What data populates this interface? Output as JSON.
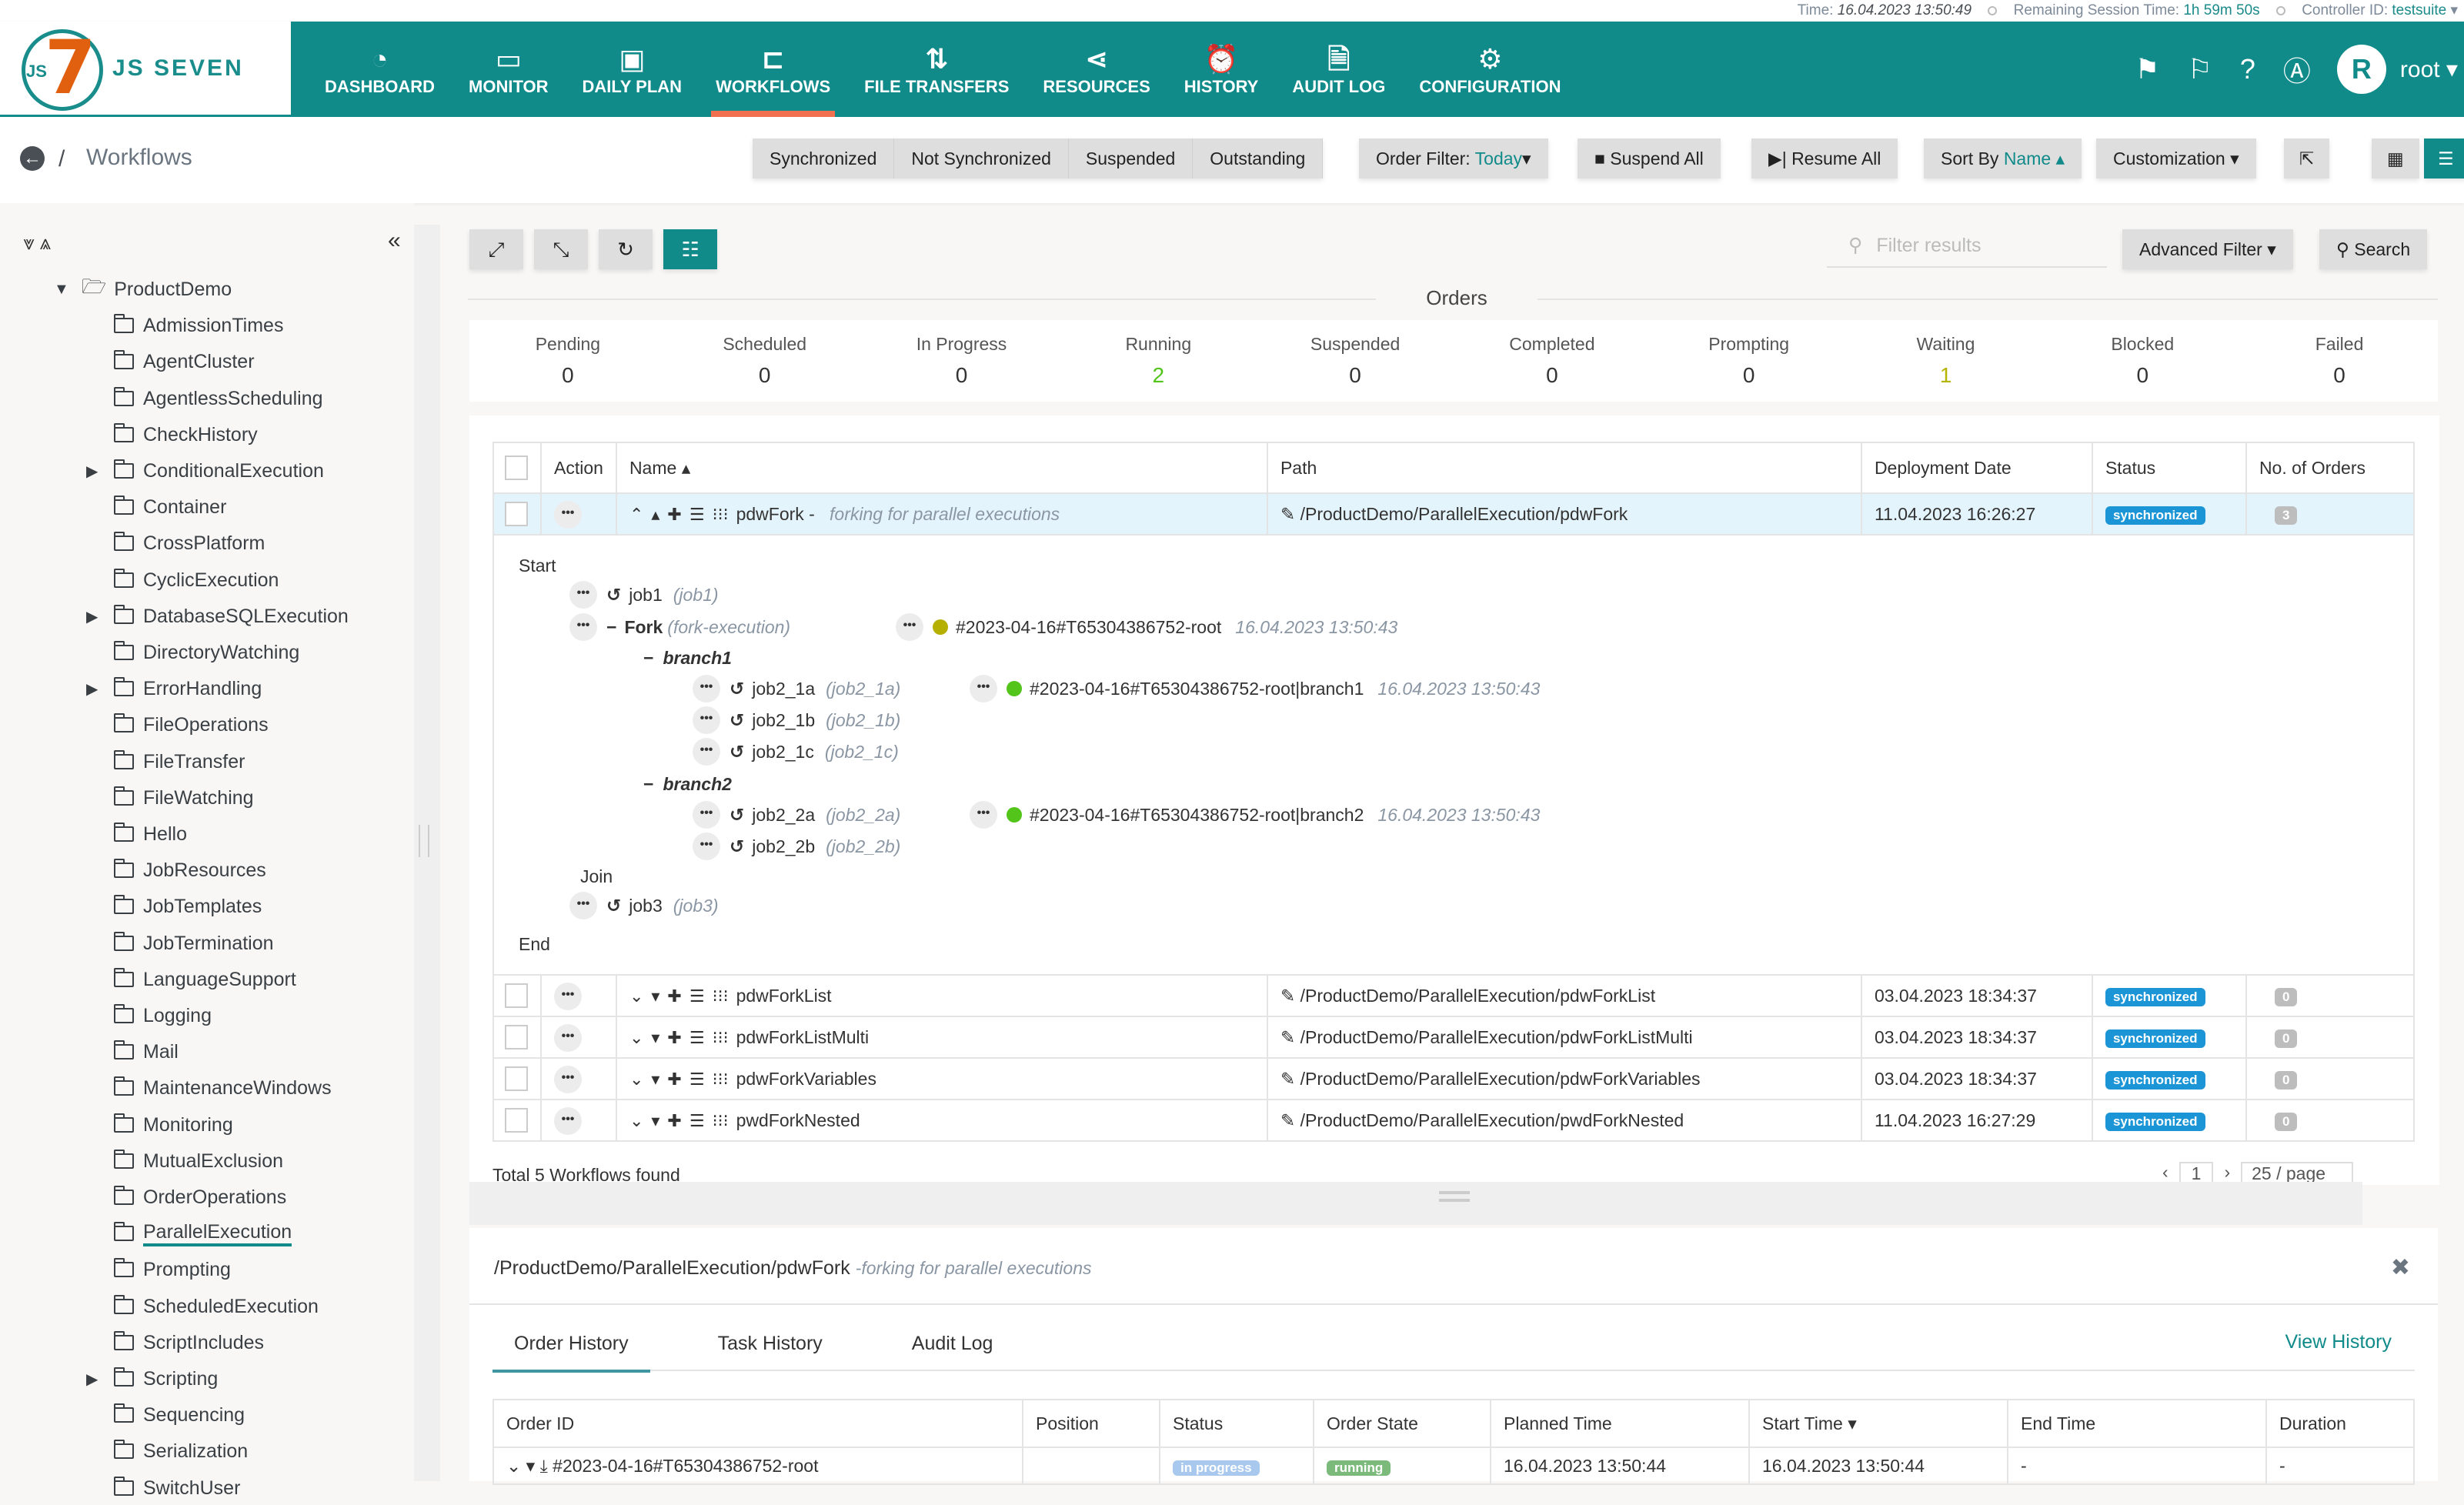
{
  "status_bar": {
    "time_label": "Time:",
    "time_value": "16.04.2023 13:50:49",
    "session_label": "Remaining Session Time:",
    "session_value": "1h 59m 50s",
    "controller_label": "Controller ID:",
    "controller_value": "testsuite"
  },
  "brand": {
    "name": "JS SEVEN",
    "mark_js": "JS",
    "mark_seven": "7"
  },
  "nav": {
    "items": [
      {
        "label": "DASHBOARD",
        "icon": "dashboard-icon",
        "glyph": "◔"
      },
      {
        "label": "MONITOR",
        "icon": "monitor-icon",
        "glyph": "▭"
      },
      {
        "label": "DAILY PLAN",
        "icon": "calendar-clock-icon",
        "glyph": "▣"
      },
      {
        "label": "WORKFLOWS",
        "icon": "workflow-icon",
        "glyph": "⊏",
        "active": true
      },
      {
        "label": "FILE TRANSFERS",
        "icon": "transfer-icon",
        "glyph": "⇅"
      },
      {
        "label": "RESOURCES",
        "icon": "share-icon",
        "glyph": "⋖"
      },
      {
        "label": "HISTORY",
        "icon": "alarm-clock-icon",
        "glyph": "⏰"
      },
      {
        "label": "AUDIT LOG",
        "icon": "file-search-icon",
        "glyph": "🗎"
      },
      {
        "label": "CONFIGURATION",
        "icon": "gears-icon",
        "glyph": "⚙"
      }
    ],
    "user_initial": "R",
    "user_name": "root"
  },
  "breadcrumb": {
    "separator": "/",
    "title": "Workflows"
  },
  "toolbar": {
    "filters": [
      "Synchronized",
      "Not Synchronized",
      "Suspended",
      "Outstanding"
    ],
    "order_filter_label": "Order Filter:",
    "order_filter_value": "Today",
    "suspend_all": "Suspend All",
    "resume_all": "Resume All",
    "sort_label": "Sort By",
    "sort_value": "Name",
    "customization": "Customization"
  },
  "sidebar": {
    "root": "ProductDemo",
    "folders": [
      {
        "name": "AdmissionTimes",
        "expandable": false
      },
      {
        "name": "AgentCluster",
        "expandable": false
      },
      {
        "name": "AgentlessScheduling",
        "expandable": false
      },
      {
        "name": "CheckHistory",
        "expandable": false
      },
      {
        "name": "ConditionalExecution",
        "expandable": true
      },
      {
        "name": "Container",
        "expandable": false
      },
      {
        "name": "CrossPlatform",
        "expandable": false
      },
      {
        "name": "CyclicExecution",
        "expandable": false
      },
      {
        "name": "DatabaseSQLExecution",
        "expandable": true
      },
      {
        "name": "DirectoryWatching",
        "expandable": false
      },
      {
        "name": "ErrorHandling",
        "expandable": true
      },
      {
        "name": "FileOperations",
        "expandable": false
      },
      {
        "name": "FileTransfer",
        "expandable": false
      },
      {
        "name": "FileWatching",
        "expandable": false
      },
      {
        "name": "Hello",
        "expandable": false
      },
      {
        "name": "JobResources",
        "expandable": false
      },
      {
        "name": "JobTemplates",
        "expandable": false
      },
      {
        "name": "JobTermination",
        "expandable": false
      },
      {
        "name": "LanguageSupport",
        "expandable": false
      },
      {
        "name": "Logging",
        "expandable": false
      },
      {
        "name": "Mail",
        "expandable": false
      },
      {
        "name": "MaintenanceWindows",
        "expandable": false
      },
      {
        "name": "Monitoring",
        "expandable": false
      },
      {
        "name": "MutualExclusion",
        "expandable": false
      },
      {
        "name": "OrderOperations",
        "expandable": false
      },
      {
        "name": "ParallelExecution",
        "expandable": false,
        "selected": true
      },
      {
        "name": "Prompting",
        "expandable": false
      },
      {
        "name": "ScheduledExecution",
        "expandable": false
      },
      {
        "name": "ScriptIncludes",
        "expandable": false
      },
      {
        "name": "Scripting",
        "expandable": true
      },
      {
        "name": "Sequencing",
        "expandable": false
      },
      {
        "name": "Serialization",
        "expandable": false
      },
      {
        "name": "SwitchUser",
        "expandable": false
      }
    ]
  },
  "search": {
    "placeholder": "Filter results",
    "advanced_filter": "Advanced Filter",
    "search_button": "Search"
  },
  "orders_summary": {
    "title": "Orders",
    "items": [
      {
        "label": "Pending",
        "value": "0",
        "color": "#333333"
      },
      {
        "label": "Scheduled",
        "value": "0",
        "color": "#333333"
      },
      {
        "label": "In Progress",
        "value": "0",
        "color": "#333333"
      },
      {
        "label": "Running",
        "value": "2",
        "color": "#52c41a"
      },
      {
        "label": "Suspended",
        "value": "0",
        "color": "#333333"
      },
      {
        "label": "Completed",
        "value": "0",
        "color": "#333333"
      },
      {
        "label": "Prompting",
        "value": "0",
        "color": "#333333"
      },
      {
        "label": "Waiting",
        "value": "1",
        "color": "#b5b500"
      },
      {
        "label": "Blocked",
        "value": "0",
        "color": "#333333"
      },
      {
        "label": "Failed",
        "value": "0",
        "color": "#333333"
      }
    ]
  },
  "workflows": {
    "columns": [
      "Action",
      "Name",
      "Path",
      "Deployment Date",
      "Status",
      "No. of Orders"
    ],
    "rows": [
      {
        "name": "pdwFork",
        "description": "forking for parallel executions",
        "path": "/ProductDemo/ParallelExecution/pdwFork",
        "deployed": "11.04.2023 16:26:27",
        "status": "synchronized",
        "orders": "3",
        "expanded": true
      },
      {
        "name": "pdwForkList",
        "description": "",
        "path": "/ProductDemo/ParallelExecution/pdwForkList",
        "deployed": "03.04.2023 18:34:37",
        "status": "synchronized",
        "orders": "0"
      },
      {
        "name": "pdwForkListMulti",
        "description": "",
        "path": "/ProductDemo/ParallelExecution/pdwForkListMulti",
        "deployed": "03.04.2023 18:34:37",
        "status": "synchronized",
        "orders": "0"
      },
      {
        "name": "pdwForkVariables",
        "description": "",
        "path": "/ProductDemo/ParallelExecution/pdwForkVariables",
        "deployed": "03.04.2023 18:34:37",
        "status": "synchronized",
        "orders": "0"
      },
      {
        "name": "pwdForkNested",
        "description": "",
        "path": "/ProductDemo/ParallelExecution/pwdForkNested",
        "deployed": "11.04.2023 16:27:29",
        "status": "synchronized",
        "orders": "0"
      }
    ],
    "total_text": "Total 5 Workflows found",
    "page": "1",
    "page_size": "25 / page"
  },
  "workflow_tree": {
    "start": "Start",
    "end": "End",
    "job1": {
      "name": "job1",
      "label": "(job1)"
    },
    "fork": {
      "name": "Fork",
      "label": "(fork-execution)",
      "order_id": "#2023-04-16#T65304386752-root",
      "order_time": "16.04.2023 13:50:43",
      "order_color": "#b5b000"
    },
    "branch1": {
      "name": "branch1",
      "jobs": [
        {
          "name": "job2_1a",
          "label": "(job2_1a)"
        },
        {
          "name": "job2_1b",
          "label": "(job2_1b)"
        },
        {
          "name": "job2_1c",
          "label": "(job2_1c)"
        }
      ],
      "order_id": "#2023-04-16#T65304386752-root|branch1",
      "order_time": "16.04.2023 13:50:43",
      "order_color": "#52c41a"
    },
    "branch2": {
      "name": "branch2",
      "jobs": [
        {
          "name": "job2_2a",
          "label": "(job2_2a)"
        },
        {
          "name": "job2_2b",
          "label": "(job2_2b)"
        }
      ],
      "order_id": "#2023-04-16#T65304386752-root|branch2",
      "order_time": "16.04.2023 13:50:43",
      "order_color": "#52c41a"
    },
    "join": "Join",
    "job3": {
      "name": "job3",
      "label": "(job3)"
    }
  },
  "detail": {
    "path": "/ProductDemo/ParallelExecution/pdwFork",
    "description": "-forking for parallel executions",
    "tabs": [
      "Order History",
      "Task History",
      "Audit Log"
    ],
    "view_history": "View History",
    "columns": [
      "Order ID",
      "Position",
      "Status",
      "Order State",
      "Planned Time",
      "Start Time",
      "End Time",
      "Duration"
    ],
    "rows": [
      {
        "order_id": "#2023-04-16#T65304386752-root",
        "position": "",
        "status": "in progress",
        "status_color": "#a8c8ee",
        "state": "running",
        "state_color": "#7cba7c",
        "planned": "16.04.2023 13:50:44",
        "start": "16.04.2023 13:50:44",
        "end": "-",
        "duration": "-"
      }
    ]
  }
}
